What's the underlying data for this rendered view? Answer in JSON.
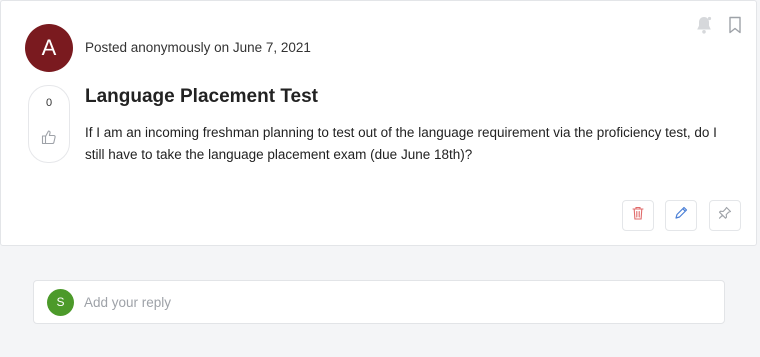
{
  "post": {
    "avatar_letter": "A",
    "posted_text": "Posted anonymously on June 7, 2021",
    "vote_count": "0",
    "title": "Language Placement Test",
    "body": "If I am an incoming freshman planning to test out of the language requirement via the proficiency test, do I still have to take the language placement exam (due June 18th)?"
  },
  "icons": {
    "bell": "bell-icon",
    "bookmark": "bookmark-icon",
    "like": "thumbs-up-icon",
    "delete": "trash-icon",
    "edit": "pencil-icon",
    "pin": "pin-icon"
  },
  "reply": {
    "avatar_letter": "S",
    "placeholder": "Add your reply"
  },
  "colors": {
    "avatar": "#7a1a1f",
    "reply_avatar": "#4c9a2a",
    "delete": "#e06a6a",
    "edit": "#4a7fd6"
  }
}
